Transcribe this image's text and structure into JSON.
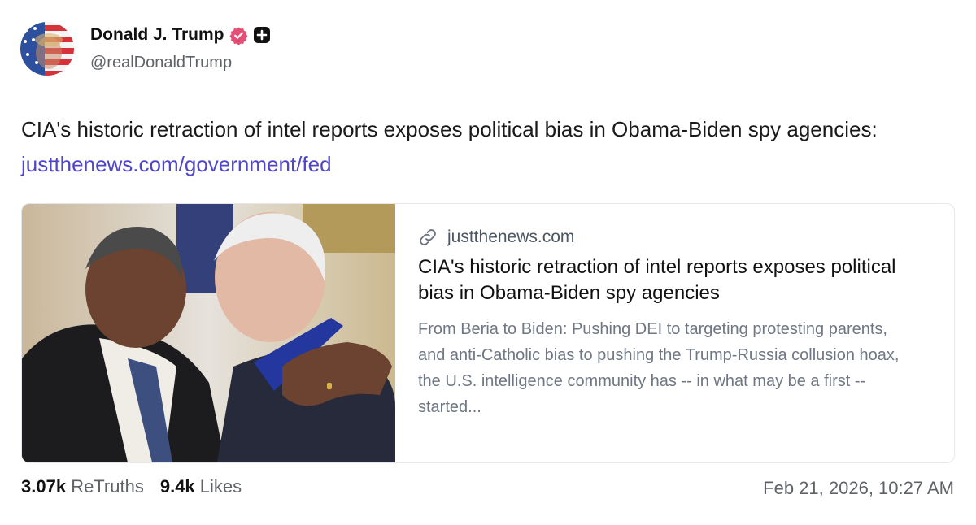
{
  "author": {
    "display_name": "Donald J. Trump",
    "handle": "@realDonaldTrump",
    "avatar_icon": "american-flag-portrait",
    "verified_icon": "verified-badge-icon",
    "verified_color": "#e44e74",
    "plus_icon": "plus-square-icon"
  },
  "post": {
    "text": "CIA's historic retraction of intel reports exposes political bias in Obama-Biden spy agencies: ",
    "link_text": "justthenews.com/government/fed",
    "link_color": "#4f46c8"
  },
  "card": {
    "domain_icon": "link-icon",
    "domain": "justthenews.com",
    "title": "CIA's historic retraction of intel reports exposes political bias in Obama-Biden spy agencies",
    "description": "From Beria to Biden: Pushing DEI to targeting protesting parents, and anti-Catholic bias to pushing the Trump-Russia collusion hoax, the U.S. intelligence community has -- in what may be a first -- started...",
    "image": "photo-two-men-laughing"
  },
  "stats": {
    "retruths_count": "3.07k",
    "retruths_label": "ReTruths",
    "likes_count": "9.4k",
    "likes_label": "Likes"
  },
  "timestamp": "Feb 21, 2026, 10:27 AM"
}
